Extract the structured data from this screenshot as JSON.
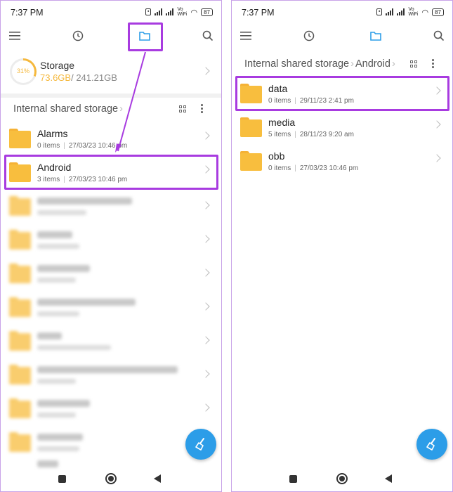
{
  "status": {
    "time": "7:37 PM",
    "vo_label": "Vo\nWiFi",
    "battery": "87"
  },
  "left": {
    "storage": {
      "label": "Storage",
      "percent": "31%",
      "used": "73.6GB",
      "total": "/ 241.21GB"
    },
    "breadcrumb": [
      "Internal shared storage"
    ],
    "folders": [
      {
        "name": "Alarms",
        "items": "0 items",
        "date": "27/03/23 10:46 pm"
      },
      {
        "name": "Android",
        "items": "3 items",
        "date": "27/03/23 10:46 pm"
      }
    ]
  },
  "right": {
    "breadcrumb": [
      "Internal shared storage",
      "Android"
    ],
    "folders": [
      {
        "name": "data",
        "items": "0 items",
        "date": "29/11/23 2:41 pm"
      },
      {
        "name": "media",
        "items": "5 items",
        "date": "28/11/23 9:20 am"
      },
      {
        "name": "obb",
        "items": "0 items",
        "date": "27/03/23 10:46 pm"
      }
    ]
  },
  "colors": {
    "accent": "#2c9de8",
    "highlight": "#a83be0",
    "folder": "#f8be3e"
  },
  "icons": {
    "menu": "hamburger-icon",
    "recent": "clock-icon",
    "files": "folder-icon",
    "search": "search-icon",
    "clean": "broom-icon"
  }
}
